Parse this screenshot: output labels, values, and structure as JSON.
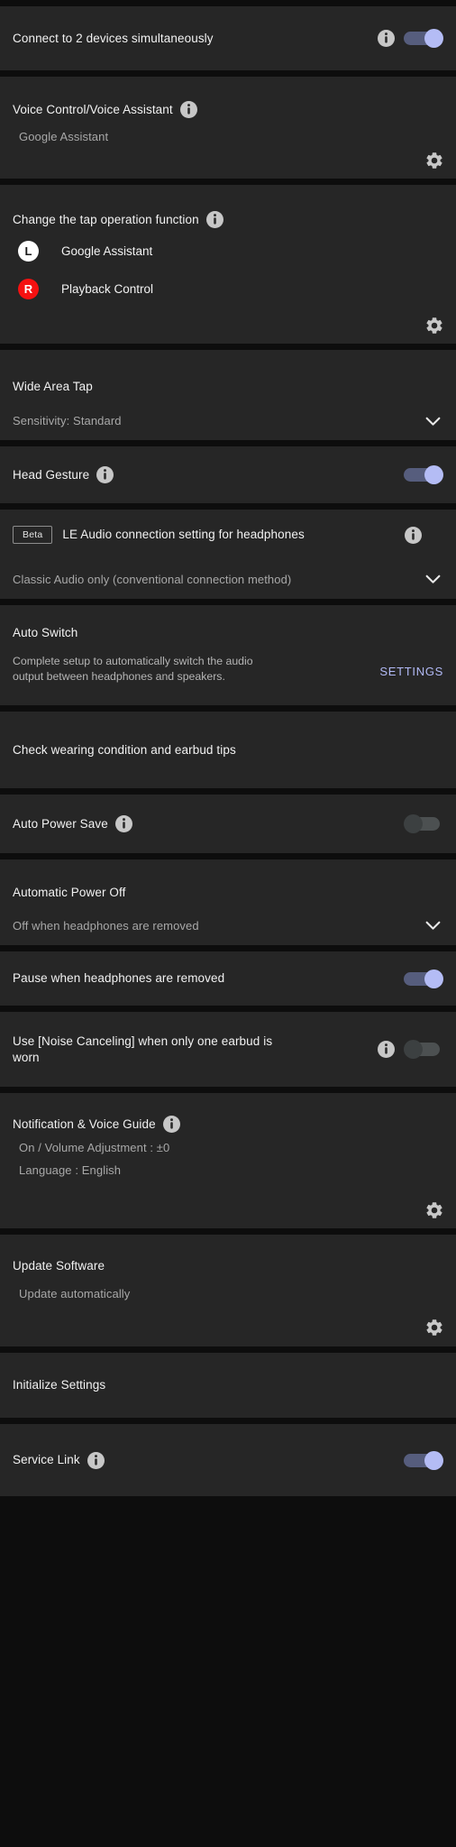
{
  "theme": {
    "card_bg": "#262626",
    "page_bg": "#0d0d0d",
    "text_primary": "#f2f2f2",
    "text_secondary": "#a8a8a8",
    "toggle_on_knob": "#b4bcf5",
    "toggle_on_track": "#565d7d",
    "toggle_off_knob": "#3c4041",
    "toggle_off_track": "#4c5051",
    "link_accent": "#b2baf6",
    "badge_left": "#ffffff",
    "badge_right": "#f51111",
    "info_icon_bg": "#c7c7c7"
  },
  "sections": {
    "multipoint": {
      "title": "Connect to 2 devices simultaneously",
      "info_icon": "info-icon",
      "toggle_state": "on"
    },
    "voice_assistant": {
      "title": "Voice Control/Voice Assistant",
      "info_icon": "info-icon",
      "value": "Google Assistant",
      "gear_icon": "gear-icon"
    },
    "tap_operation": {
      "title": "Change the tap operation function",
      "info_icon": "info-icon",
      "assignments": [
        {
          "side": "L",
          "side_name": "left-earbud-badge",
          "function": "Google Assistant"
        },
        {
          "side": "R",
          "side_name": "right-earbud-badge",
          "function": "Playback Control"
        }
      ],
      "gear_icon": "gear-icon"
    },
    "wide_area_tap": {
      "title": "Wide Area Tap",
      "value": "Sensitivity: Standard",
      "chevron_icon": "chevron-down-icon"
    },
    "head_gesture": {
      "title": "Head Gesture",
      "info_icon": "info-icon",
      "toggle_state": "on"
    },
    "le_audio": {
      "badge": "Beta",
      "title": "LE Audio connection setting for headphones",
      "info_icon": "info-icon",
      "value": "Classic Audio only (conventional connection method)",
      "chevron_icon": "chevron-down-icon"
    },
    "auto_switch": {
      "title": "Auto Switch",
      "description": "Complete setup to automatically switch the audio output between headphones and speakers.",
      "action_label": "SETTINGS"
    },
    "wearing_check": {
      "title": "Check wearing condition and earbud tips"
    },
    "auto_power_save": {
      "title": "Auto Power Save",
      "info_icon": "info-icon",
      "toggle_state": "off"
    },
    "automatic_power_off": {
      "title": "Automatic Power Off",
      "value": "Off when headphones are removed",
      "chevron_icon": "chevron-down-icon"
    },
    "pause_when_removed": {
      "title": "Pause when headphones are removed",
      "toggle_state": "on"
    },
    "nc_one_earbud": {
      "title": "Use [Noise Canceling] when only one earbud is worn",
      "info_icon": "info-icon",
      "toggle_state": "off"
    },
    "notification_voice_guide": {
      "title": "Notification & Voice Guide",
      "info_icon": "info-icon",
      "value_line1": "On / Volume Adjustment : ±0",
      "value_line2": "Language : English",
      "gear_icon": "gear-icon"
    },
    "update_software": {
      "title": "Update Software",
      "value": "Update automatically",
      "gear_icon": "gear-icon"
    },
    "initialize_settings": {
      "title": "Initialize Settings"
    },
    "service_link": {
      "title": "Service Link",
      "info_icon": "info-icon",
      "toggle_state": "on"
    }
  }
}
